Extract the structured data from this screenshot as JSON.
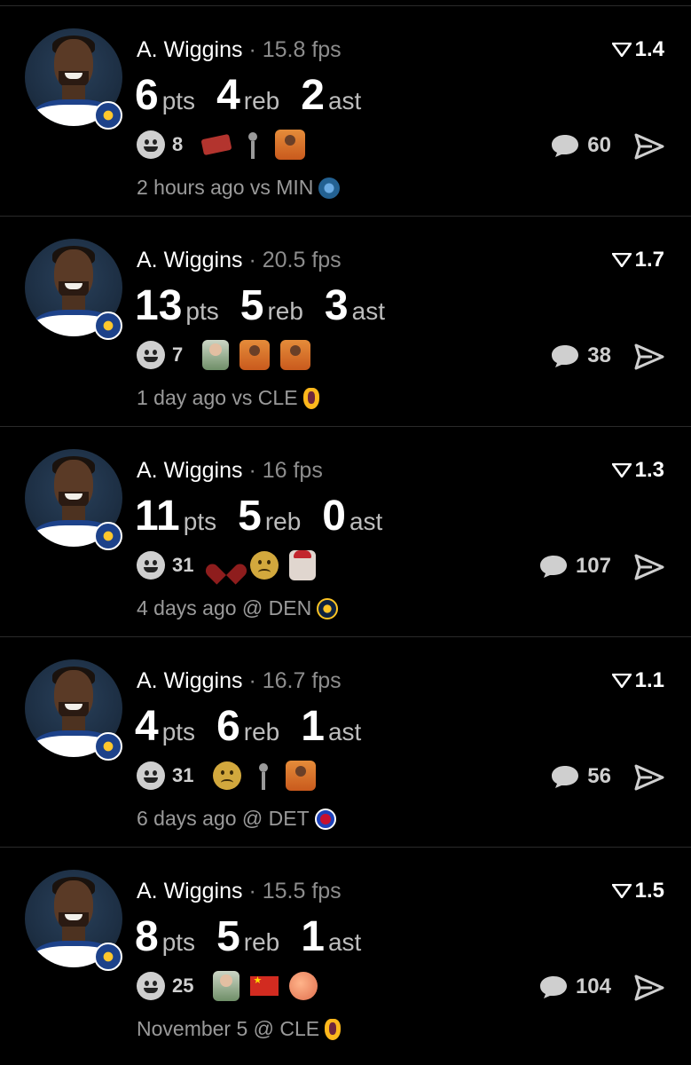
{
  "cards": [
    {
      "player": "A. Wiggins",
      "separator": "·",
      "fps": "15.8 fps",
      "rating": "1.4",
      "pts": "6",
      "reb": "4",
      "ast": "2",
      "pts_label": "pts",
      "reb_label": "reb",
      "ast_label": "ast",
      "reaction_count": "8",
      "reactions": [
        "brick",
        "golfer",
        "drake"
      ],
      "comments": "60",
      "meta": "2 hours ago vs MIN",
      "team_logo": "timberwolves-logo"
    },
    {
      "player": "A. Wiggins",
      "separator": "·",
      "fps": "20.5 fps",
      "rating": "1.7",
      "pts": "13",
      "reb": "5",
      "ast": "3",
      "pts_label": "pts",
      "reb_label": "reb",
      "ast_label": "ast",
      "reaction_count": "7",
      "reactions": [
        "success-kid",
        "drake",
        "drake"
      ],
      "comments": "38",
      "meta": "1 day ago vs CLE",
      "team_logo": "cavaliers-logo"
    },
    {
      "player": "A. Wiggins",
      "separator": "·",
      "fps": "16 fps",
      "rating": "1.3",
      "pts": "11",
      "reb": "5",
      "ast": "0",
      "pts_label": "pts",
      "reb_label": "reb",
      "ast_label": "ast",
      "reaction_count": "31",
      "reactions": [
        "broken-heart",
        "frown",
        "man-in-cap"
      ],
      "comments": "107",
      "meta": "4 days ago @ DEN",
      "team_logo": "nuggets-logo"
    },
    {
      "player": "A. Wiggins",
      "separator": "·",
      "fps": "16.7 fps",
      "rating": "1.1",
      "pts": "4",
      "reb": "6",
      "ast": "1",
      "pts_label": "pts",
      "reb_label": "reb",
      "ast_label": "ast",
      "reaction_count": "31",
      "reactions": [
        "frown",
        "golfer",
        "drake"
      ],
      "comments": "56",
      "meta": "6 days ago @ DET",
      "team_logo": "pistons-logo"
    },
    {
      "player": "A. Wiggins",
      "separator": "·",
      "fps": "15.5 fps",
      "rating": "1.5",
      "pts": "8",
      "reb": "5",
      "ast": "1",
      "pts_label": "pts",
      "reb_label": "reb",
      "ast_label": "ast",
      "reaction_count": "25",
      "reactions": [
        "success-kid",
        "china-flag",
        "peach"
      ],
      "comments": "104",
      "meta": "November 5 @ CLE",
      "team_logo": "cavaliers-logo"
    }
  ]
}
